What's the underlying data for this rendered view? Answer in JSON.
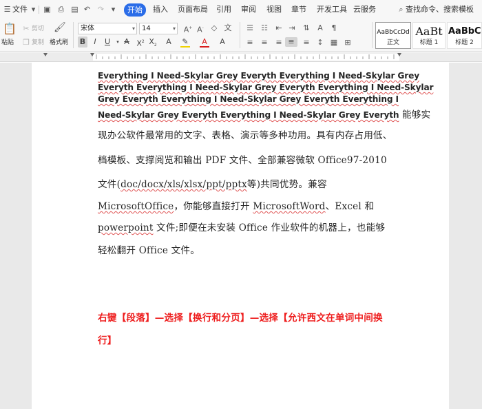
{
  "menubar": {
    "file_label": "文件",
    "menu_tabs": [
      "开始",
      "插入",
      "页面布局",
      "引用",
      "审阅",
      "视图",
      "章节",
      "开发工具",
      "云服务"
    ],
    "active_tab": "开始",
    "search_label": "查找命令、搜索模板",
    "accent_color": "#2b6de8"
  },
  "toolbar": {
    "paste_label": "粘贴",
    "cut_label": "剪切",
    "copy_label": "复制",
    "format_painter_label": "格式刷",
    "font_name": "宋体",
    "font_size": "14",
    "styles": [
      {
        "preview": "AaBbCcDd",
        "caption": "正文"
      },
      {
        "preview": "AaBt",
        "caption": "标题 1"
      },
      {
        "preview": "AaBbC",
        "caption": "标题 2"
      }
    ]
  },
  "document": {
    "lines": [
      {
        "segments": [
          {
            "text": "Everything I Need-Skylar Grey Everyth Everything I Need-Skylar Grey",
            "kind": "eng",
            "squiggle": true
          }
        ]
      },
      {
        "segments": [
          {
            "text": "Everyth Everything I Need-Skylar Grey Everyth Everything I Need-Skylar",
            "kind": "eng",
            "squiggle": true
          }
        ]
      },
      {
        "segments": [
          {
            "text": "Grey Everyth Everything I Need-Skylar Grey Everyth Everything I",
            "kind": "eng",
            "squiggle": true
          }
        ]
      },
      {
        "segments": [
          {
            "text": "Need-Skylar Grey Everyth Everything I Need-Skylar Grey Everyth",
            "kind": "eng",
            "squiggle": true
          },
          {
            "text": " 能够实",
            "kind": "cjk",
            "squiggle": false
          }
        ]
      },
      {
        "segments": [
          {
            "text": "现办公软件最常用的文字、表格、演示等多种功用。具有内存占用低、",
            "kind": "cjk",
            "squiggle": false
          }
        ]
      },
      {
        "segments": [
          {
            "text": "档模板、支撑阅览和输出 PDF 文件、全部兼容微软 Office97-2010",
            "kind": "cjk",
            "squiggle": false
          }
        ]
      },
      {
        "segments": [
          {
            "text": "文件(",
            "kind": "cjk",
            "squiggle": false
          },
          {
            "text": "doc/docx/xls/xlsx/ppt/pptx",
            "kind": "cjk",
            "squiggle": true
          },
          {
            "text": "等)共同优势。兼容",
            "kind": "cjk",
            "squiggle": false
          }
        ]
      },
      {
        "segments": [
          {
            "text": "MicrosoftOffice",
            "kind": "cjk",
            "squiggle": true
          },
          {
            "text": "，你能够直接打开 ",
            "kind": "cjk",
            "squiggle": false
          },
          {
            "text": "MicrosoftWord",
            "kind": "cjk",
            "squiggle": true
          },
          {
            "text": "、Excel 和",
            "kind": "cjk",
            "squiggle": false
          }
        ]
      },
      {
        "segments": [
          {
            "text": "powerpoint",
            "kind": "cjk",
            "squiggle": true
          },
          {
            "text": " 文件;即便在未安装 Office 作业软件的机器上，也能够",
            "kind": "cjk",
            "squiggle": false
          }
        ]
      },
      {
        "segments": [
          {
            "text": "轻松翻开 Office 文件。",
            "kind": "cjk",
            "squiggle": false
          }
        ]
      },
      {
        "segments": [
          {
            "text": "右键【段落】—选择【换行和分页】—选择【允许西文在单词中间换",
            "kind": "red",
            "squiggle": false
          }
        ]
      },
      {
        "segments": [
          {
            "text": "行】",
            "kind": "red",
            "squiggle": false
          }
        ]
      }
    ],
    "squiggle_color": "#e05454",
    "instruction_color": "#ee1c1c"
  }
}
